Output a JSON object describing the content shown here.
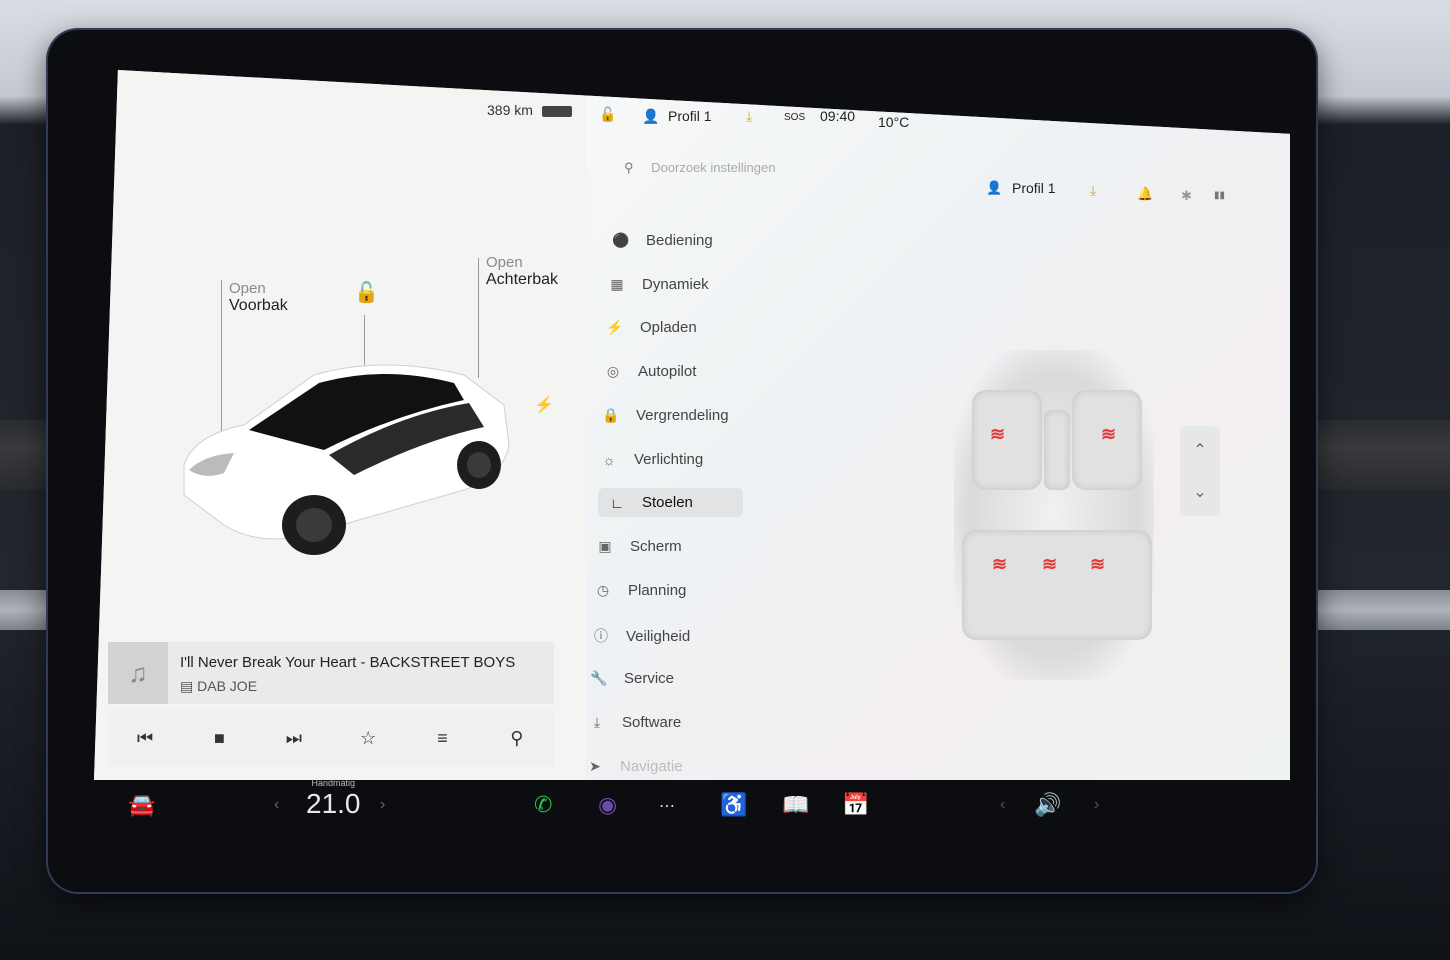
{
  "status": {
    "range": "389 km",
    "profile": "Profil 1",
    "sos": "SOS",
    "time": "09:40",
    "temp": "10°C"
  },
  "car": {
    "frunk_action": "Open",
    "frunk_label": "Voorbak",
    "trunk_action": "Open",
    "trunk_label": "Achterbak"
  },
  "media": {
    "song": "I'll Never Break Your Heart - BACKSTREET BOYS",
    "station": "DAB JOE"
  },
  "settings": {
    "search_placeholder": "Doorzoek instellingen",
    "profile": "Profil 1",
    "menu": [
      "Bediening",
      "Dynamiek",
      "Opladen",
      "Autopilot",
      "Vergrendeling",
      "Verlichting",
      "Stoelen",
      "Scherm",
      "Planning",
      "Veiligheid",
      "Service",
      "Software",
      "Navigatie"
    ],
    "active": "Stoelen"
  },
  "climate": {
    "mode": "Handmatig",
    "temperature": "21.0"
  },
  "colors": {
    "accent_orange": "#f0a020",
    "heat_red": "#e23a3a",
    "phone_green": "#2fbf4a"
  }
}
